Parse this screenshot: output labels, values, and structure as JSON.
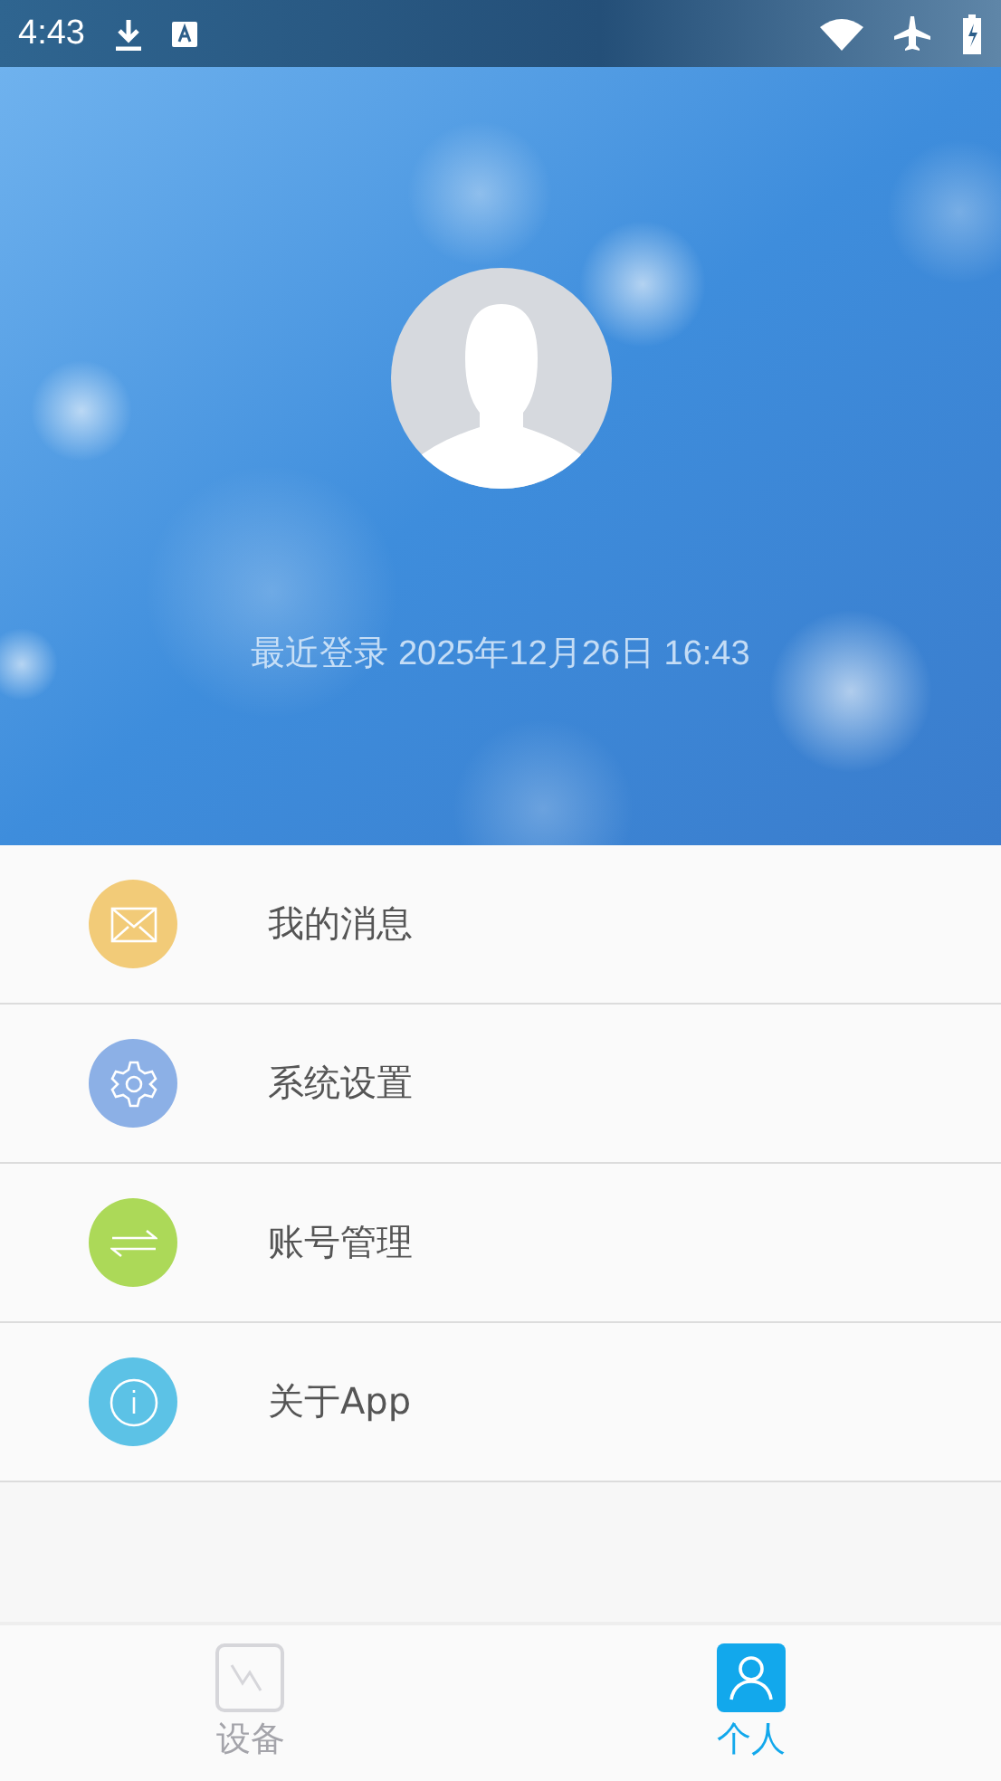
{
  "status_bar": {
    "time": "4:43"
  },
  "profile": {
    "last_login": "最近登录 2025年12月26日 16:43"
  },
  "menu": [
    {
      "kind": "mail",
      "label": "我的消息",
      "color": "#f2cb78"
    },
    {
      "kind": "gear",
      "label": "系统设置",
      "color": "#8cb0e6"
    },
    {
      "kind": "swap",
      "label": "账号管理",
      "color": "#acd958"
    },
    {
      "kind": "info",
      "label": "关于App",
      "color": "#5cc2e6"
    }
  ],
  "tabs": [
    {
      "kind": "device",
      "label": "设备",
      "selected": false
    },
    {
      "kind": "person",
      "label": "个人",
      "selected": true
    }
  ]
}
